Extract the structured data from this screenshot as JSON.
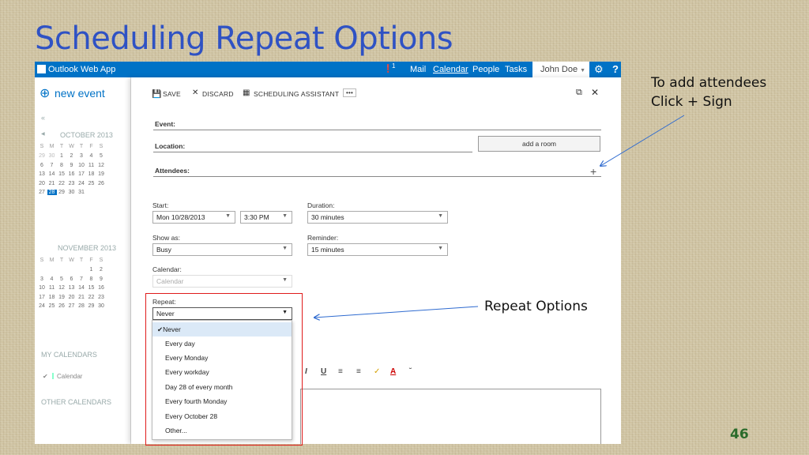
{
  "slide": {
    "title": "Scheduling Repeat Options",
    "callout_attendees_line1": "To add attendees",
    "callout_attendees_line2": "Click + Sign",
    "callout_repeat": "Repeat Options",
    "page_number": "46"
  },
  "app": {
    "name": "Outlook Web App",
    "notification_count": "1",
    "nav": [
      "Mail",
      "Calendar",
      "People",
      "Tasks"
    ],
    "user": "John Doe",
    "colors": {
      "topbar": "#0072c6",
      "title": "#2f52c4",
      "highlight": "#e01b1b"
    }
  },
  "left": {
    "new_event": "new event",
    "month1": "OCTOBER 2013",
    "month2": "NOVEMBER 2013",
    "weekdays": [
      "S",
      "M",
      "T",
      "W",
      "T",
      "F",
      "S"
    ],
    "oct_rows": [
      [
        "29",
        "30",
        "1",
        "2",
        "3",
        "4",
        "5"
      ],
      [
        "6",
        "7",
        "8",
        "9",
        "10",
        "11",
        "12"
      ],
      [
        "13",
        "14",
        "15",
        "16",
        "17",
        "18",
        "19"
      ],
      [
        "20",
        "21",
        "22",
        "23",
        "24",
        "25",
        "26"
      ],
      [
        "27",
        "28",
        "29",
        "30",
        "31",
        "",
        ""
      ]
    ],
    "nov_rows": [
      [
        "",
        "",
        "",
        "",
        "",
        "1",
        "2"
      ],
      [
        "3",
        "4",
        "5",
        "6",
        "7",
        "8",
        "9"
      ],
      [
        "10",
        "11",
        "12",
        "13",
        "14",
        "15",
        "16"
      ],
      [
        "17",
        "18",
        "19",
        "20",
        "21",
        "22",
        "23"
      ],
      [
        "24",
        "25",
        "26",
        "27",
        "28",
        "29",
        "30"
      ]
    ],
    "today": "28",
    "my_calendars": "MY CALENDARS",
    "calendar_item": "Calendar",
    "other_calendars": "OTHER CALENDARS"
  },
  "toolbar": {
    "save": "SAVE",
    "discard": "DISCARD",
    "assistant": "SCHEDULING ASSISTANT",
    "more": "•••"
  },
  "form": {
    "event_label": "Event:",
    "location_label": "Location:",
    "add_room": "add a room",
    "attendees_label": "Attendees:",
    "add_attendee": "+",
    "start_label": "Start:",
    "start_date": "Mon 10/28/2013",
    "start_time": "3:30 PM",
    "duration_label": "Duration:",
    "duration": "30 minutes",
    "show_as_label": "Show as:",
    "show_as": "Busy",
    "reminder_label": "Reminder:",
    "reminder": "15 minutes",
    "calendar_label": "Calendar:",
    "calendar": "Calendar",
    "repeat_label": "Repeat:",
    "repeat": "Never"
  },
  "repeat_options": [
    "Never",
    "Every day",
    "Every Monday",
    "Every workday",
    "Day 28 of every month",
    "Every fourth Monday",
    "Every October 28",
    "Other..."
  ],
  "selected_option": "Never"
}
